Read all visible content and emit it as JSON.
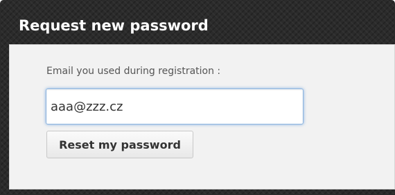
{
  "dialog": {
    "title": "Request new password"
  },
  "form": {
    "email_label": "Email you used during registration :",
    "email_value": "aaa@zzz.cz",
    "reset_button_label": "Reset my password"
  }
}
